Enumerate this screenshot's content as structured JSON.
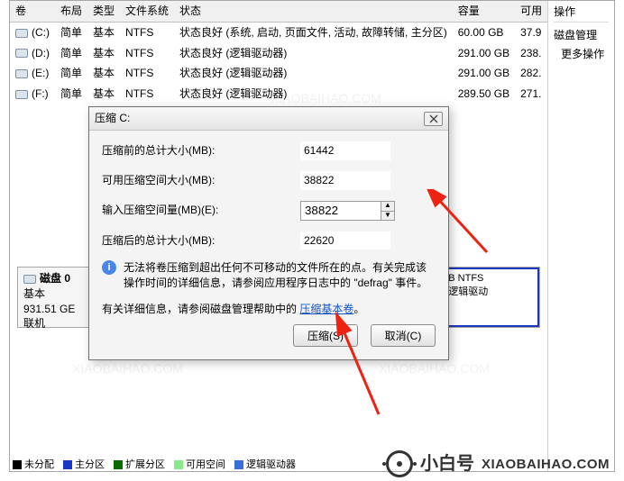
{
  "table": {
    "headers": [
      "卷",
      "布局",
      "类型",
      "文件系统",
      "状态",
      "容量",
      "可用"
    ],
    "rows": [
      {
        "vol": "(C:)",
        "layout": "简单",
        "type": "基本",
        "fs": "NTFS",
        "status": "状态良好 (系统, 启动, 页面文件, 活动, 故障转储, 主分区)",
        "cap": "60.00 GB",
        "free": "37.9"
      },
      {
        "vol": "(D:)",
        "layout": "简单",
        "type": "基本",
        "fs": "NTFS",
        "status": "状态良好 (逻辑驱动器)",
        "cap": "291.00 GB",
        "free": "238."
      },
      {
        "vol": "(E:)",
        "layout": "简单",
        "type": "基本",
        "fs": "NTFS",
        "status": "状态良好 (逻辑驱动器)",
        "cap": "291.00 GB",
        "free": "282."
      },
      {
        "vol": "(F:)",
        "layout": "简单",
        "type": "基本",
        "fs": "NTFS",
        "status": "状态良好 (逻辑驱动器)",
        "cap": "289.50 GB",
        "free": "271."
      }
    ]
  },
  "right": {
    "head": "操作",
    "item1": "磁盘管理",
    "item2": "更多操作"
  },
  "disk": {
    "title": "磁盘 0",
    "type": "基本",
    "size": "931.51 GE",
    "online": "联机",
    "part_fs": "B NTFS",
    "part_status": "逻辑驱动"
  },
  "legend": {
    "un": "未分配",
    "pr": "主分区",
    "ex": "扩展分区",
    "fr": "可用空间",
    "lo": "逻辑驱动器"
  },
  "modal": {
    "title": "压缩 C:",
    "f1": "压缩前的总计大小(MB):",
    "v1": "61442",
    "f2": "可用压缩空间大小(MB):",
    "v2": "38822",
    "f3": "输入压缩空间量(MB)(E):",
    "v3": "38822",
    "f4": "压缩后的总计大小(MB):",
    "v4": "22620",
    "info": "无法将卷压缩到超出任何不可移动的文件所在的点。有关完成该操作时间的详细信息，请参阅应用程序日志中的 \"defrag\" 事件。",
    "help_prefix": "有关详细信息，请参阅磁盘管理帮助中的",
    "help_link": "压缩基本卷",
    "help_suffix": "。",
    "btn_shrink": "压缩(S)",
    "btn_cancel": "取消(C)"
  },
  "wm": {
    "txt1": "小白号",
    "txt2": "XIAOBAIHAO.COM"
  }
}
